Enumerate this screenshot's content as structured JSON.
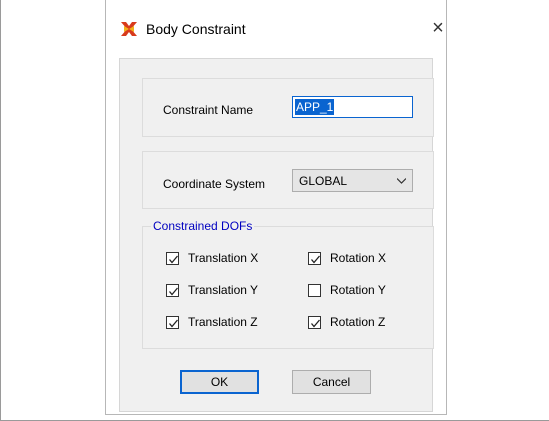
{
  "dialog": {
    "title": "Body Constraint",
    "close_glyph": "×",
    "constraint_name_label": "Constraint Name",
    "constraint_name_value": "APP_1",
    "coordinate_system_label": "Coordinate System",
    "coordinate_system_value": "GLOBAL",
    "dofs_group_label": "Constrained DOFs",
    "dofs": [
      {
        "label": "Translation X",
        "checked": true
      },
      {
        "label": "Translation Y",
        "checked": true
      },
      {
        "label": "Translation Z",
        "checked": true
      },
      {
        "label": "Rotation X",
        "checked": true
      },
      {
        "label": "Rotation Y",
        "checked": false
      },
      {
        "label": "Rotation Z",
        "checked": true
      }
    ],
    "ok_label": "OK",
    "cancel_label": "Cancel"
  },
  "colors": {
    "accent": "#0a64d0",
    "group_label": "#0000c0",
    "app_icon": "#d83a1c",
    "app_icon_secondary": "#f2b21c"
  },
  "icons": {
    "app": "etabs-app-icon",
    "close": "close-icon",
    "dropdown": "chevron-down-icon"
  }
}
